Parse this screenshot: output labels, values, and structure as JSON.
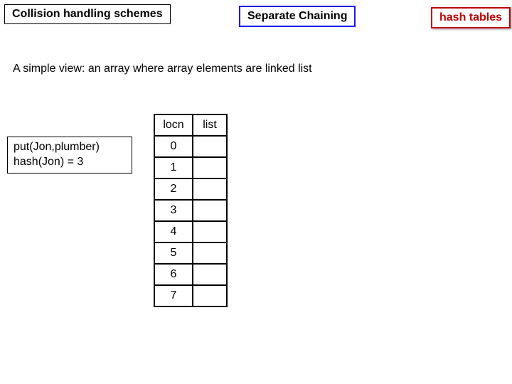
{
  "header": {
    "topic": "Collision handling schemes",
    "method": "Separate Chaining",
    "category": "hash tables"
  },
  "description": "A simple view: an array where array elements are linked list",
  "annotation": {
    "line1": "put(Jon,plumber)",
    "line2": "hash(Jon) = 3"
  },
  "table": {
    "headers": {
      "c0": "locn",
      "c1": "list"
    },
    "rows": [
      {
        "locn": "0",
        "list": ""
      },
      {
        "locn": "1",
        "list": ""
      },
      {
        "locn": "2",
        "list": ""
      },
      {
        "locn": "3",
        "list": ""
      },
      {
        "locn": "4",
        "list": ""
      },
      {
        "locn": "5",
        "list": ""
      },
      {
        "locn": "6",
        "list": ""
      },
      {
        "locn": "7",
        "list": ""
      }
    ]
  }
}
